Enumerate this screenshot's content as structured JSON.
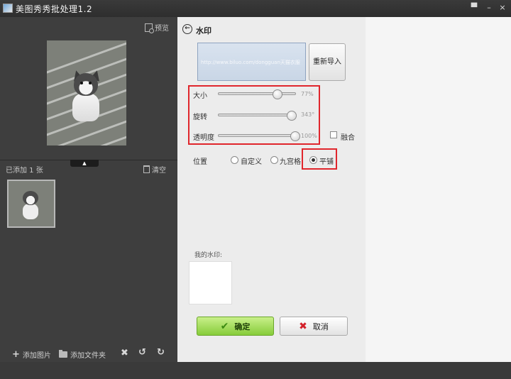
{
  "window": {
    "title": "美图秀秀批处理1.2",
    "pin_glyph": "▀",
    "minimize_glyph": "–",
    "close_glyph": "×"
  },
  "left": {
    "preview_label": "预览",
    "collapse_glyph": "▲",
    "added_count": "已添加 1 张",
    "clear_label": "清空",
    "toolbar": {
      "add_image": "添加图片",
      "add_folder": "添加文件夹",
      "delete_glyph": "✖",
      "rotate_left_glyph": "↺",
      "rotate_right_glyph": "↻"
    }
  },
  "dialog": {
    "back_glyph": "←",
    "title": "水印",
    "watermark_text": "http://www.biluo.com/dongguan天猫衣服",
    "reimport": "重新导入",
    "sliders": [
      {
        "label": "大小",
        "value": 77,
        "display": "77%"
      },
      {
        "label": "旋转",
        "value": 343,
        "max": 360,
        "display": "343°"
      },
      {
        "label": "透明度",
        "value": 100,
        "display": "100%"
      }
    ],
    "blend_label": "融合",
    "position": {
      "label": "位置",
      "options": [
        "自定义",
        "九宫格",
        "平铺"
      ],
      "selected": "平铺"
    },
    "my_watermark_label": "我的水印:",
    "ok": "确定",
    "cancel": "取消",
    "ok_glyph": "✔",
    "cancel_glyph": "✖"
  },
  "colors": {
    "highlight": "#e0262c",
    "ok_green": "#86cc3a"
  }
}
